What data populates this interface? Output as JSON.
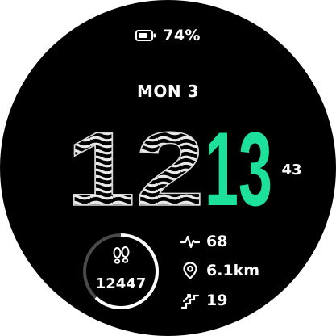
{
  "status": {
    "battery_percent": "74%",
    "battery_level": 0.74
  },
  "date": "MON 3",
  "time": {
    "hours": "12",
    "minutes": "13",
    "seconds": "43"
  },
  "steps": {
    "value": "12447",
    "goal_progress": 0.62
  },
  "stats": {
    "heart_rate": "68",
    "distance": "6.1km",
    "floors": "19"
  },
  "icons": {
    "battery": "battery-icon",
    "steps": "footsteps-icon",
    "heart_rate": "heart-rate-icon",
    "distance": "location-pin-icon",
    "floors": "stairs-icon"
  },
  "colors": {
    "background": "#000000",
    "accent": "#1de19b",
    "text": "#ffffff",
    "ring_track": "#4a4a4a"
  }
}
